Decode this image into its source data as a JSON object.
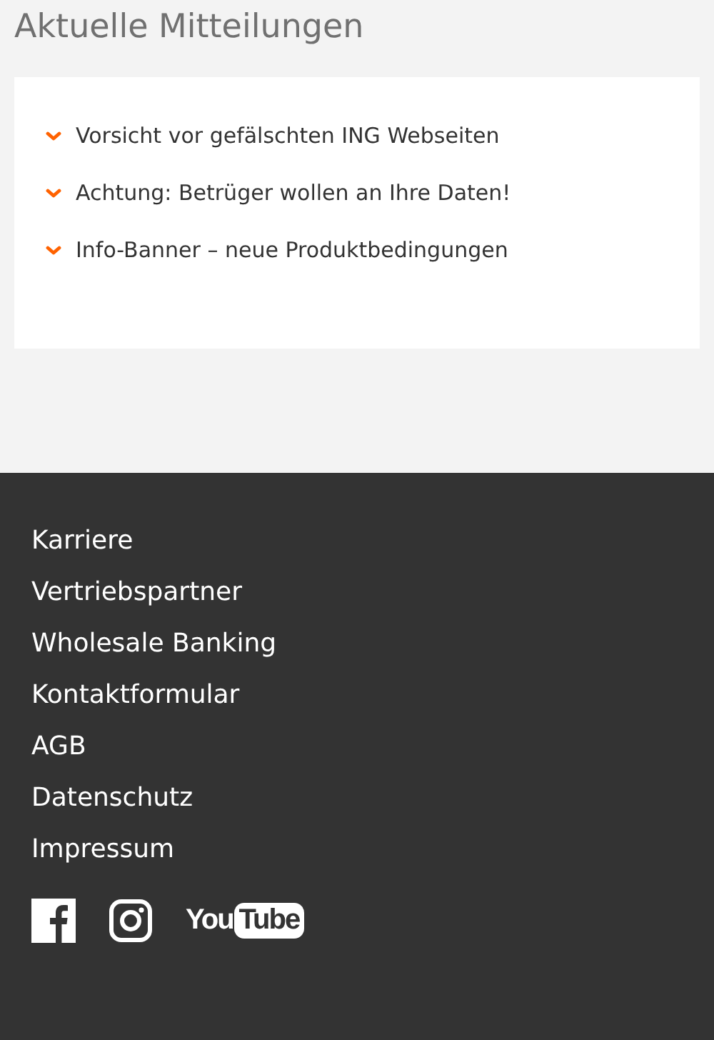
{
  "title": "Aktuelle Mitteilungen",
  "notices": [
    {
      "label": "Vorsicht vor gefälschten ING Webseiten"
    },
    {
      "label": "Achtung: Betrüger wollen an Ihre Daten!"
    },
    {
      "label": "Info-Banner – neue Produktbedingungen"
    }
  ],
  "footer_links": [
    "Karriere",
    "Vertriebspartner",
    "Wholesale Banking",
    "Kontaktformular",
    "AGB",
    "Datenschutz",
    "Impressum"
  ],
  "social": [
    {
      "kind": "facebook"
    },
    {
      "kind": "instagram"
    },
    {
      "kind": "youtube",
      "text_1": "You",
      "text_2": "Tube"
    }
  ]
}
